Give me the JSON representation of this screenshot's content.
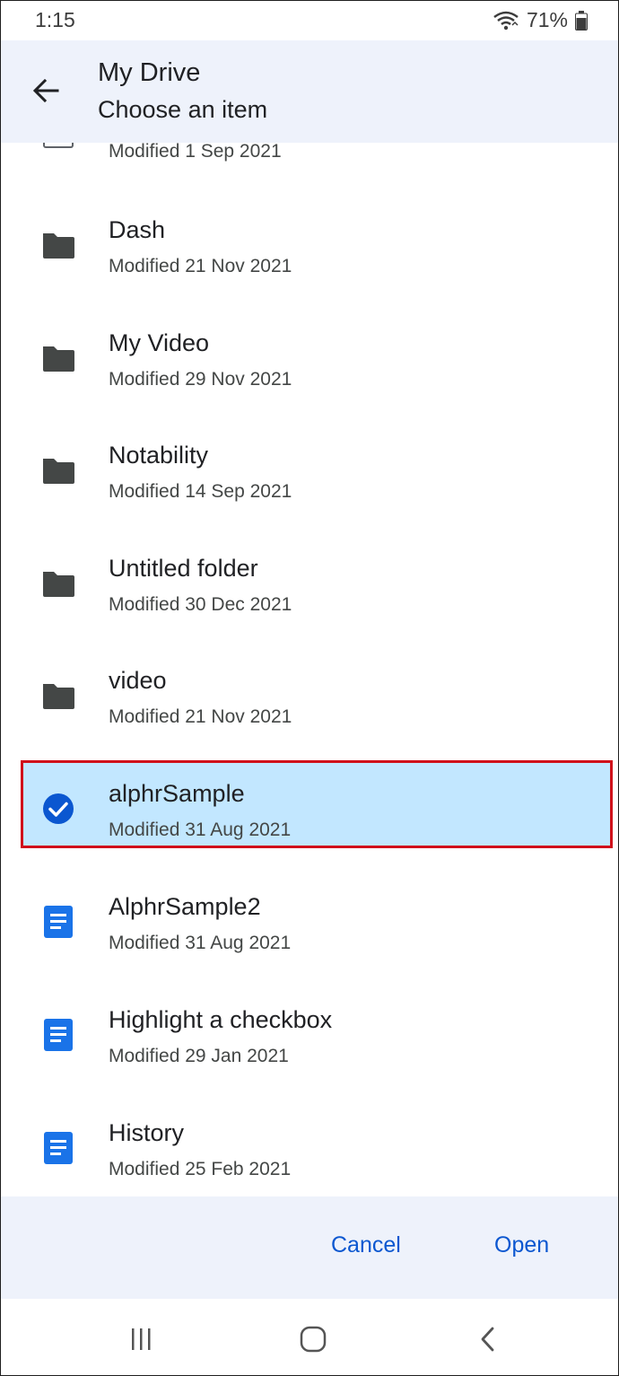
{
  "status": {
    "time": "1:15",
    "battery": "71%"
  },
  "header": {
    "title": "My Drive",
    "subtitle": "Choose an item"
  },
  "partial_item": {
    "meta": "Modified 1 Sep 2021"
  },
  "items": [
    {
      "name": "Dash",
      "meta": "Modified 21 Nov 2021",
      "icon": "folder-icon"
    },
    {
      "name": "My Video",
      "meta": "Modified 29 Nov 2021",
      "icon": "folder-icon"
    },
    {
      "name": "Notability",
      "meta": "Modified 14 Sep 2021",
      "icon": "folder-icon"
    },
    {
      "name": "Untitled folder",
      "meta": "Modified 30 Dec 2021",
      "icon": "folder-icon"
    },
    {
      "name": "video",
      "meta": "Modified 21 Nov 2021",
      "icon": "folder-icon"
    },
    {
      "name": "alphrSample",
      "meta": "Modified 31 Aug 2021",
      "icon": "check-circle-icon",
      "selected": true
    },
    {
      "name": "AlphrSample2",
      "meta": "Modified 31 Aug 2021",
      "icon": "document-icon"
    },
    {
      "name": "Highlight a checkbox",
      "meta": "Modified 29 Jan 2021",
      "icon": "document-icon"
    },
    {
      "name": "History",
      "meta": "Modified 25 Feb 2021",
      "icon": "document-icon"
    }
  ],
  "footer": {
    "cancel_label": "Cancel",
    "open_label": "Open"
  },
  "colors": {
    "header_bg": "#eef2fb",
    "selected_bg": "#c2e7ff",
    "highlight_border": "#d0101b",
    "accent": "#0b57d0",
    "doc_blue": "#1a73e8",
    "folder": "#444746"
  },
  "navbar": {
    "icons": [
      "recent-apps-icon",
      "home-icon",
      "back-nav-icon"
    ]
  }
}
